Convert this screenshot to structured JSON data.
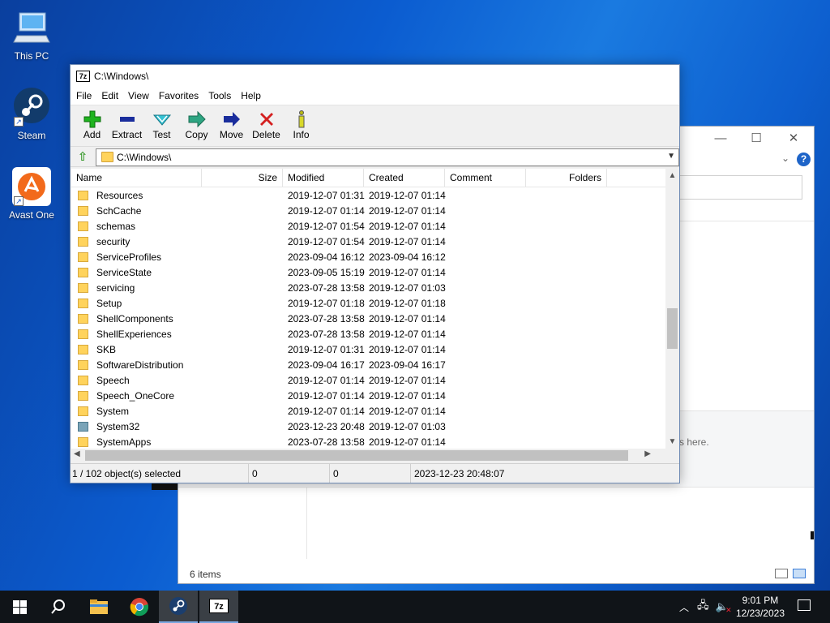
{
  "desktop": {
    "icons": [
      {
        "label": "This PC"
      },
      {
        "label": "Steam"
      },
      {
        "label": "Avast One"
      }
    ]
  },
  "explorer_bg": {
    "drop_hint": "s here.",
    "status": "6 items"
  },
  "sevenzip": {
    "title": "C:\\Windows\\",
    "menu": [
      "File",
      "Edit",
      "View",
      "Favorites",
      "Tools",
      "Help"
    ],
    "toolbar": [
      {
        "label": "Add",
        "icon": "plus-icon",
        "color": "#1e9e1e"
      },
      {
        "label": "Extract",
        "icon": "minus-icon",
        "color": "#1a2d9c"
      },
      {
        "label": "Test",
        "icon": "check-icon",
        "color": "#27b0c2"
      },
      {
        "label": "Copy",
        "icon": "copy-arrow-icon",
        "color": "#2c9c7a"
      },
      {
        "label": "Move",
        "icon": "move-arrow-icon",
        "color": "#1a2d9c"
      },
      {
        "label": "Delete",
        "icon": "delete-x-icon",
        "color": "#d42020"
      },
      {
        "label": "Info",
        "icon": "info-icon",
        "color": "#b8b814"
      }
    ],
    "path": "C:\\Windows\\",
    "columns": [
      "Name",
      "Size",
      "Modified",
      "Created",
      "Comment",
      "Folders"
    ],
    "rows": [
      {
        "name": "Resources",
        "modified": "2019-12-07 01:31",
        "created": "2019-12-07 01:14"
      },
      {
        "name": "SchCache",
        "modified": "2019-12-07 01:14",
        "created": "2019-12-07 01:14"
      },
      {
        "name": "schemas",
        "modified": "2019-12-07 01:54",
        "created": "2019-12-07 01:14"
      },
      {
        "name": "security",
        "modified": "2019-12-07 01:54",
        "created": "2019-12-07 01:14"
      },
      {
        "name": "ServiceProfiles",
        "modified": "2023-09-04 16:12",
        "created": "2023-09-04 16:12"
      },
      {
        "name": "ServiceState",
        "modified": "2023-09-05 15:19",
        "created": "2019-12-07 01:14"
      },
      {
        "name": "servicing",
        "modified": "2023-07-28 13:58",
        "created": "2019-12-07 01:03"
      },
      {
        "name": "Setup",
        "modified": "2019-12-07 01:18",
        "created": "2019-12-07 01:18"
      },
      {
        "name": "ShellComponents",
        "modified": "2023-07-28 13:58",
        "created": "2019-12-07 01:14"
      },
      {
        "name": "ShellExperiences",
        "modified": "2023-07-28 13:58",
        "created": "2019-12-07 01:14"
      },
      {
        "name": "SKB",
        "modified": "2019-12-07 01:31",
        "created": "2019-12-07 01:14"
      },
      {
        "name": "SoftwareDistribution",
        "modified": "2023-09-04 16:17",
        "created": "2023-09-04 16:17"
      },
      {
        "name": "Speech",
        "modified": "2019-12-07 01:14",
        "created": "2019-12-07 01:14"
      },
      {
        "name": "Speech_OneCore",
        "modified": "2019-12-07 01:14",
        "created": "2019-12-07 01:14"
      },
      {
        "name": "System",
        "modified": "2019-12-07 01:14",
        "created": "2019-12-07 01:14"
      },
      {
        "name": "System32",
        "modified": "2023-12-23 20:48",
        "created": "2019-12-07 01:03",
        "alt": true
      },
      {
        "name": "SystemApps",
        "modified": "2023-07-28 13:58",
        "created": "2019-12-07 01:14"
      }
    ],
    "status": {
      "selected": "1 / 102 object(s) selected",
      "size": "0",
      "packed": "0",
      "date": "2023-12-23 20:48:07"
    }
  },
  "taskbar": {
    "time": "9:01 PM",
    "date": "12/23/2023"
  }
}
